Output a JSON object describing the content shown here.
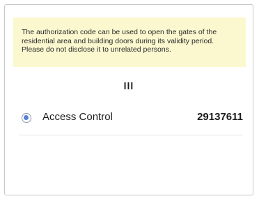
{
  "notice": {
    "text": "The authorization code can be used to open the gates of the residential area and building doors during its validity period. Please do not disclose it to unrelated persons."
  },
  "qr_title": "lll",
  "access_items": [
    {
      "label": "Access Control",
      "code": "29137611",
      "selected": true
    }
  ],
  "colors": {
    "notice_background": "#fbf8cf",
    "radio_accent": "#5b7fd6",
    "divider": "#e5e5ea"
  }
}
